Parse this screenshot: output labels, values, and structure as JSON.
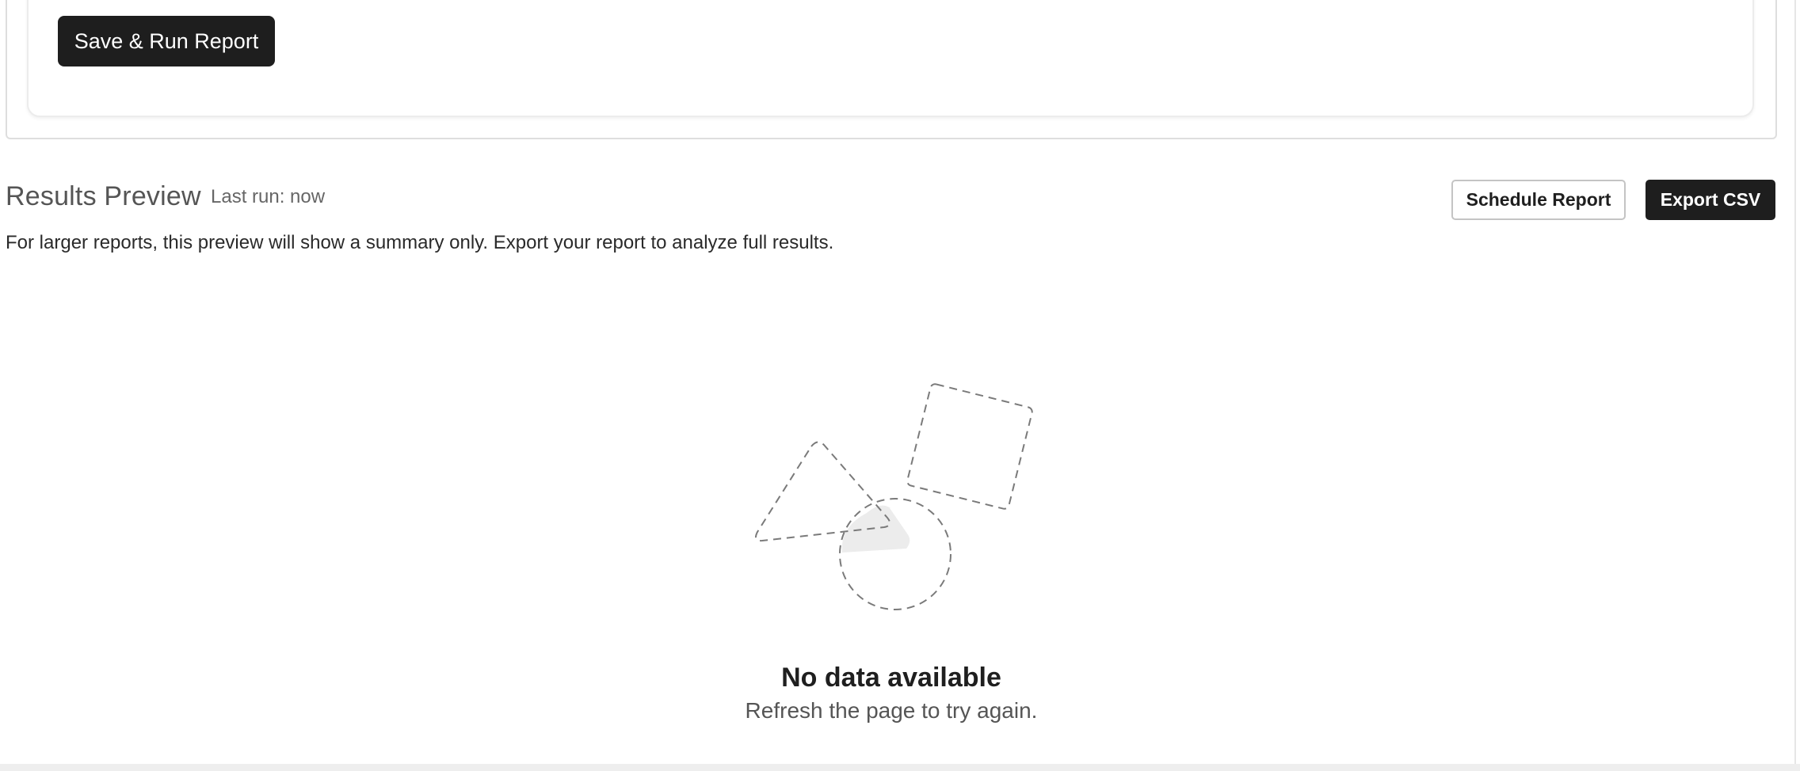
{
  "builder": {
    "save_run_label": "Save & Run Report"
  },
  "results": {
    "title": "Results Preview",
    "last_run": "Last run: now",
    "schedule_label": "Schedule Report",
    "export_label": "Export CSV",
    "note": "For larger reports, this preview will show a summary only. Export your report to analyze full results."
  },
  "empty_state": {
    "illustration": "empty-shapes-icon",
    "title": "No data available",
    "subtitle": "Refresh the page to try again."
  },
  "colors": {
    "primary_button": "#1e1e1e",
    "secondary_border": "#c4c4c4",
    "title_text": "#555555"
  }
}
